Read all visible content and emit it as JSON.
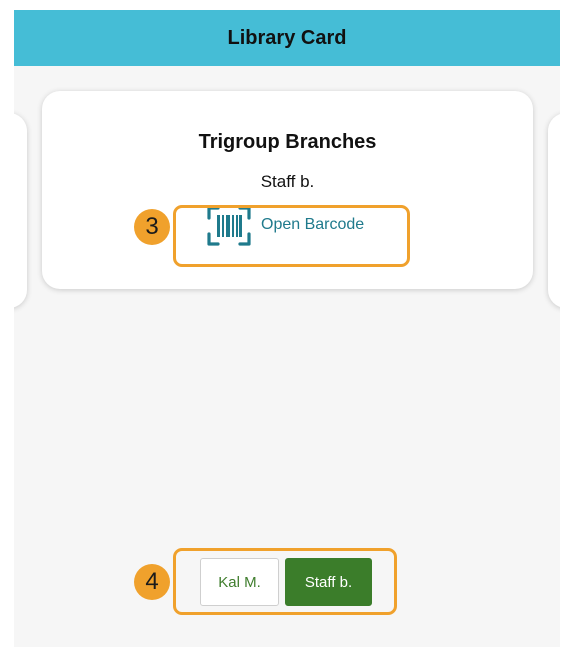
{
  "header": {
    "title": "Library Card"
  },
  "card": {
    "branch": "Trigroup Branches",
    "patron": "Staff b.",
    "barcode_button_label": "Open Barcode",
    "barcode_icon": "barcode-scan-icon"
  },
  "callouts": {
    "barcode": "3",
    "account_switcher": "4"
  },
  "account_switcher": {
    "options": [
      "Kal M.",
      "Staff b."
    ],
    "selected": "Staff b."
  },
  "colors": {
    "header_bg": "#45bdd6",
    "link": "#1f7a8c",
    "callout": "#f0a12c",
    "selected_segment": "#3b7d2a"
  }
}
